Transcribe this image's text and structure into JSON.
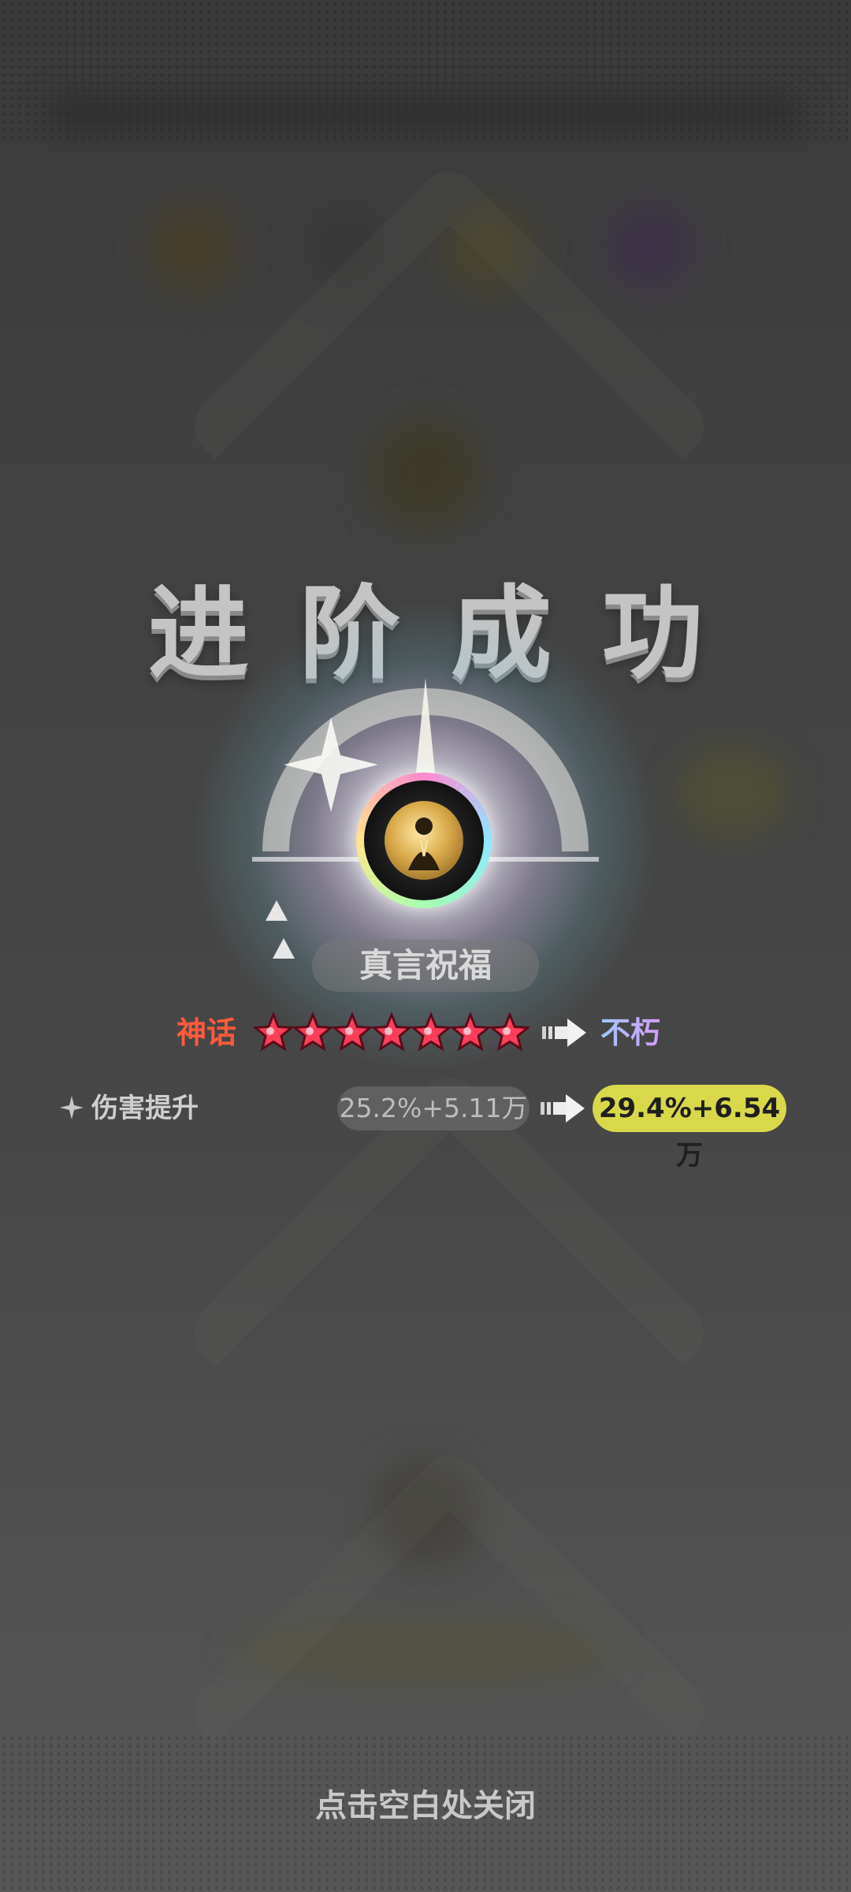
{
  "title": "进阶成功",
  "skill": {
    "name": "真言祝福",
    "icon": "praying-figure-icon"
  },
  "rarity": {
    "from_label": "神话",
    "from_color": "#ff5a3c",
    "stars": 7,
    "star_color": "#ff3e5a",
    "to_label": "不朽",
    "to_color": "#b9a6ff"
  },
  "stat": {
    "label": "伤害提升",
    "old_value": "25.2%+5.11万",
    "new_value": "29.4%+6.54万",
    "new_value_bg": "#d9d84a"
  },
  "close_hint": "点击空白处关闭"
}
